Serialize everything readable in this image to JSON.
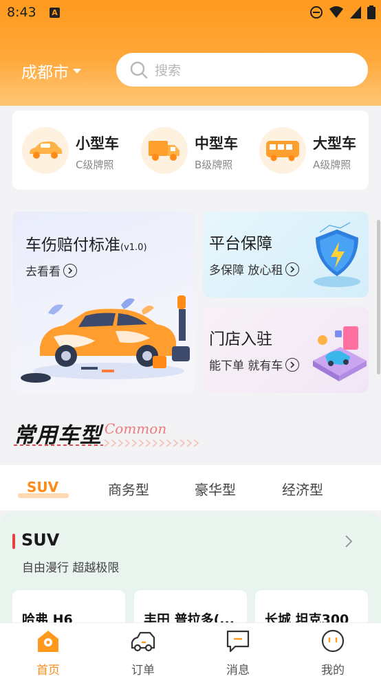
{
  "status_bar": {
    "time": "8:43",
    "notif_badge": "A"
  },
  "header": {
    "city": "成都市",
    "search_placeholder": "搜索"
  },
  "categories": [
    {
      "title": "小型车",
      "subtitle": "C级牌照",
      "icon": "small-car-icon"
    },
    {
      "title": "中型车",
      "subtitle": "B级牌照",
      "icon": "truck-icon"
    },
    {
      "title": "大型车",
      "subtitle": "A级牌照",
      "icon": "bus-icon"
    }
  ],
  "banners": {
    "left": {
      "title": "车伤赔付标准",
      "version": "(v1.0)",
      "subtitle": "去看看"
    },
    "right_top": {
      "title": "平台保障",
      "subtitle": "多保障 放心租"
    },
    "right_bottom": {
      "title": "门店入驻",
      "subtitle": "能下单 就有车"
    }
  },
  "section": {
    "title": "常用车型",
    "subtitle": "Common"
  },
  "tabs": [
    "SUV",
    "商务型",
    "豪华型",
    "经济型"
  ],
  "active_tab": "SUV",
  "suv_section": {
    "title": "SUV",
    "subtitle": "自由漫行 超越极限",
    "cars": [
      "哈弗 H6",
      "丰田 普拉多(...",
      "长城 坦克300"
    ]
  },
  "bottom_nav": [
    {
      "label": "首页",
      "icon": "home-icon",
      "active": true
    },
    {
      "label": "订单",
      "icon": "car-order-icon",
      "active": false
    },
    {
      "label": "消息",
      "icon": "message-icon",
      "active": false
    },
    {
      "label": "我的",
      "icon": "profile-icon",
      "active": false
    }
  ],
  "colors": {
    "accent": "#ff8a17",
    "header": "#ff9a1e",
    "suv_bar": "#e64040"
  }
}
